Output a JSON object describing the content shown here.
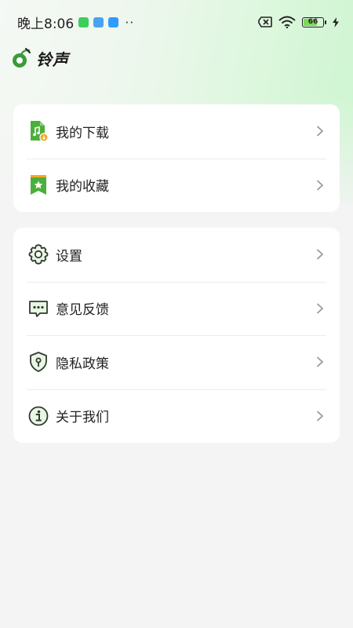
{
  "status_bar": {
    "time": "晚上8:06",
    "battery_level": "66",
    "battery_fraction": 0.66,
    "icons": [
      "app-notification-icon",
      "calendar-notification-icon",
      "cloud-notification-icon",
      "more-dots-icon",
      "sim-x-icon",
      "wifi-icon",
      "battery-icon",
      "charging-bolt-icon"
    ],
    "more": "··"
  },
  "header": {
    "title": "铃声",
    "logo_icon": "music-note-logo-icon",
    "accent_color": "#3c9a3c"
  },
  "card1": {
    "items": [
      {
        "label": "我的下载",
        "icon": "music-file-download-icon"
      },
      {
        "label": "我的收藏",
        "icon": "bookmark-star-icon"
      }
    ]
  },
  "card2": {
    "items": [
      {
        "label": "设置",
        "icon": "gear-icon"
      },
      {
        "label": "意见反馈",
        "icon": "chat-bubble-icon"
      },
      {
        "label": "隐私政策",
        "icon": "shield-icon"
      },
      {
        "label": "关于我们",
        "icon": "info-icon"
      }
    ]
  },
  "colors": {
    "icon_green": "#4caf3c",
    "icon_dark": "#2f3b2f",
    "chevron": "#9a9a9a",
    "badge_orange": "#f5a623"
  }
}
